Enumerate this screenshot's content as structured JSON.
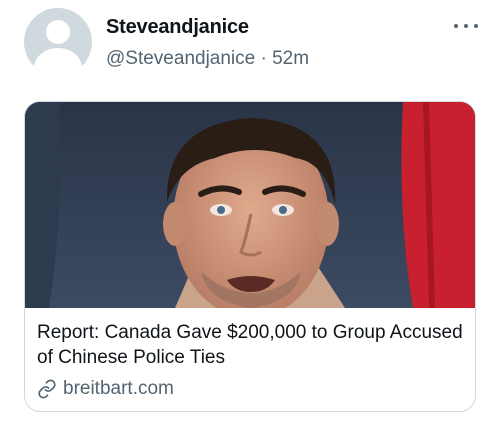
{
  "tweet": {
    "display_name": "Steveandjanice",
    "handle": "@Steveandjanice",
    "separator": "·",
    "time": "52m"
  },
  "icons": {
    "avatar": "default-avatar-icon",
    "more": "more-dots-icon",
    "link": "link-icon"
  },
  "link_card": {
    "title": "Report: Canada Gave $200,000 to Group Accused of Chinese Police Ties",
    "domain": "breitbart.com"
  },
  "colors": {
    "text_primary": "#0f1419",
    "text_secondary": "#536471",
    "border": "#cfd9de",
    "flag_red": "#c8202e"
  }
}
